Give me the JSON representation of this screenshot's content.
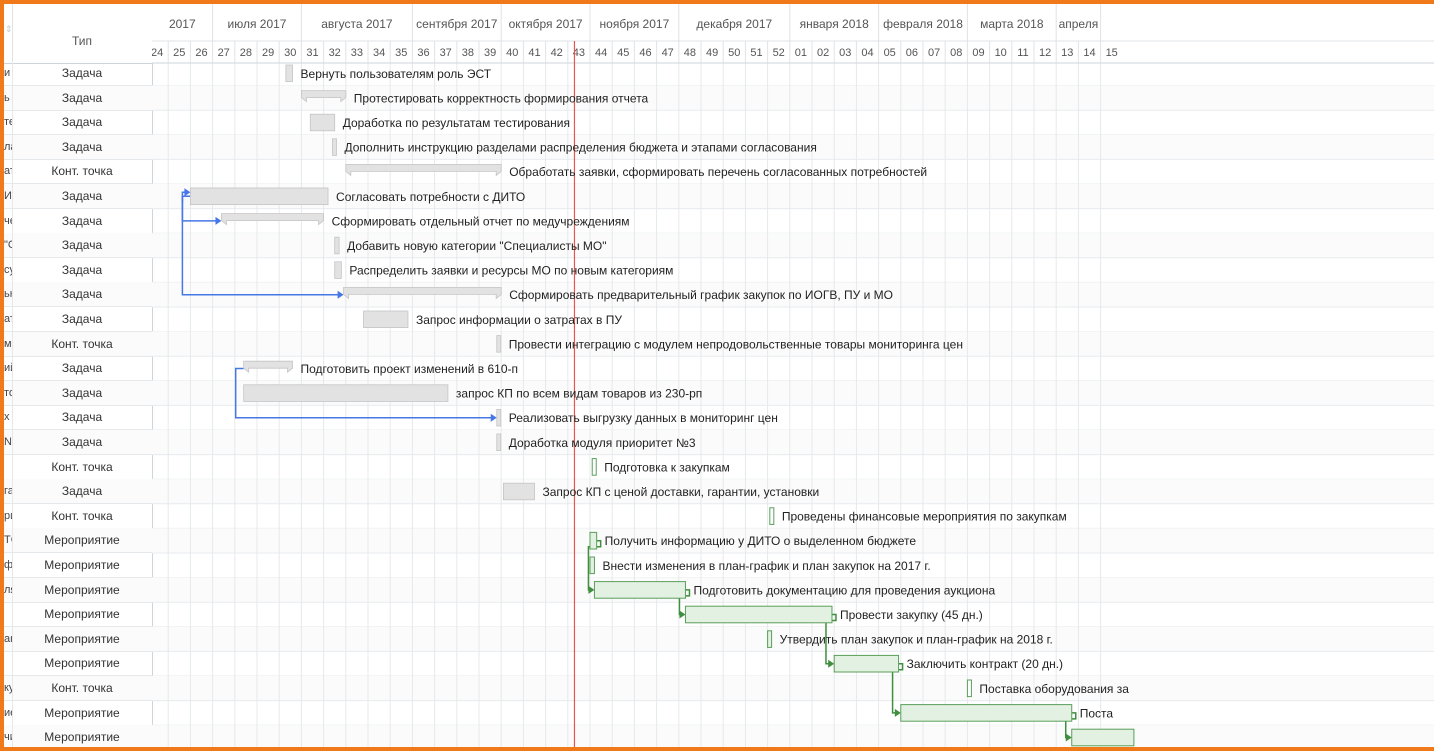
{
  "columns": {
    "type_header": "Тип",
    "sort_icon": "sort-icon"
  },
  "timeline": {
    "months": [
      {
        "label": "2017",
        "from": 24,
        "to": 26
      },
      {
        "label": "июля 2017",
        "from": 27,
        "to": 30
      },
      {
        "label": "августа 2017",
        "from": 31,
        "to": 35
      },
      {
        "label": "сентября 2017",
        "from": 36,
        "to": 39
      },
      {
        "label": "октября 2017",
        "from": 40,
        "to": 43
      },
      {
        "label": "ноября 2017",
        "from": 44,
        "to": 47
      },
      {
        "label": "декабря 2017",
        "from": 48,
        "to": 52
      },
      {
        "label": "января 2018",
        "from": 53,
        "to": 56
      },
      {
        "label": "февраля 2018",
        "from": 57,
        "to": 60
      },
      {
        "label": "марта 2018",
        "from": 61,
        "to": 64
      },
      {
        "label": "апреля",
        "from": 65,
        "to": 66
      }
    ],
    "weeks": [
      "24",
      "25",
      "26",
      "27",
      "28",
      "29",
      "30",
      "31",
      "32",
      "33",
      "34",
      "35",
      "36",
      "37",
      "38",
      "39",
      "40",
      "41",
      "42",
      "43",
      "44",
      "45",
      "46",
      "47",
      "48",
      "49",
      "50",
      "51",
      "52",
      "01",
      "02",
      "03",
      "04",
      "05",
      "06",
      "07",
      "08",
      "09",
      "10",
      "11",
      "12",
      "13",
      "14",
      "15"
    ],
    "today_week": 43.3,
    "colors": {
      "task_fill": "#e2e2e2",
      "task_border": "#c4c4c4",
      "green_fill": "#e3f1e3",
      "green_border": "#5a9e5a",
      "link_blue": "#4677e6",
      "link_green": "#3f8f3f",
      "today_line": "#e8564f"
    }
  },
  "rows": [
    {
      "left": "и",
      "type": "Задача",
      "bar": {
        "kind": "task",
        "start": 30.3,
        "end": 30.6
      },
      "label": "Вернуть пользователям роль ЭСТ"
    },
    {
      "left": "ь с",
      "type": "Задача",
      "bar": {
        "kind": "summary",
        "start": 31.0,
        "end": 33.0
      },
      "label": "Протестировать корректность формирования отчета"
    },
    {
      "left": "те",
      "type": "Задача",
      "bar": {
        "kind": "task",
        "start": 31.4,
        "end": 32.5
      },
      "label": "Доработка по результатам тестирования"
    },
    {
      "left": "ла",
      "type": "Задача",
      "bar": {
        "kind": "task",
        "start": 32.4,
        "end": 32.5
      },
      "label": "Дополнить инструкцию разделами распределения бюджета и этапами согласования"
    },
    {
      "left": "ат",
      "type": "Конт. точка",
      "bar": {
        "kind": "summary",
        "start": 33.0,
        "end": 40.0
      },
      "label": "Обработать заявки, сформировать перечень согласованных потребностей"
    },
    {
      "left": "И",
      "type": "Задача",
      "bar": {
        "kind": "task",
        "start": 26.0,
        "end": 32.2
      },
      "label": "Согласовать потребности с ДИТО"
    },
    {
      "left": "че",
      "type": "Задача",
      "bar": {
        "kind": "summary",
        "start": 27.4,
        "end": 32.0
      },
      "label": "Сформировать отдельный отчет по медучреждениям"
    },
    {
      "left": "\"С",
      "type": "Задача",
      "bar": {
        "kind": "task",
        "start": 32.5,
        "end": 32.7
      },
      "label": "Добавить новую категории \"Специалисты МО\""
    },
    {
      "left": "су",
      "type": "Задача",
      "bar": {
        "kind": "task",
        "start": 32.5,
        "end": 32.8
      },
      "label": "Распределить заявки и ресурсы МО по новым категориям"
    },
    {
      "left": "ьн",
      "type": "Задача",
      "bar": {
        "kind": "summary",
        "start": 32.9,
        "end": 40.0
      },
      "label": "Сформировать предварительный график закупок по ИОГВ, ПУ и МО"
    },
    {
      "left": "ат",
      "type": "Задача",
      "bar": {
        "kind": "task",
        "start": 33.8,
        "end": 35.8
      },
      "label": "Запрос информации о затратах в ПУ"
    },
    {
      "left": "м",
      "type": "Конт. точка",
      "bar": {
        "kind": "task",
        "start": 39.8,
        "end": 39.95
      },
      "label": "Провести интеграцию с модулем непродовольственные товары мониторинга цен"
    },
    {
      "left": "ий",
      "type": "Задача",
      "bar": {
        "kind": "summary",
        "start": 28.4,
        "end": 30.6
      },
      "label": "Подготовить проект изменений в 610-п"
    },
    {
      "left": "то",
      "type": "Задача",
      "bar": {
        "kind": "task",
        "start": 28.4,
        "end": 37.6
      },
      "label": "запрос КП по всем видам товаров из 230-рп"
    },
    {
      "left": "х в",
      "type": "Задача",
      "bar": {
        "kind": "task",
        "start": 39.8,
        "end": 39.95
      },
      "label": "Реализовать выгрузку данных в мониторинг цен"
    },
    {
      "left": "N",
      "type": "Задача",
      "bar": {
        "kind": "task",
        "start": 39.8,
        "end": 39.95
      },
      "label": "Доработка модуля приоритет №3"
    },
    {
      "left": "",
      "type": "Конт. точка",
      "bar": {
        "kind": "milestone",
        "start": 44.1,
        "end": 44.2
      },
      "label": "Подготовка к закупкам"
    },
    {
      "left": "га",
      "type": "Задача",
      "bar": {
        "kind": "task",
        "start": 40.1,
        "end": 41.5
      },
      "label": "Запрос КП с ценой доставки, гарантии, установки"
    },
    {
      "left": "ри",
      "type": "Конт. точка",
      "bar": {
        "kind": "milestone",
        "start": 52.1,
        "end": 52.2
      },
      "label": "Проведены финансовые мероприятия по закупкам"
    },
    {
      "left": "ТС",
      "type": "Мероприятие",
      "bar": {
        "kind": "green",
        "start": 44.0,
        "end": 44.3
      },
      "label": "Получить информацию у ДИТО о выделенном бюджете"
    },
    {
      "left": "ф",
      "type": "Мероприятие",
      "bar": {
        "kind": "green",
        "start": 44.0,
        "end": 44.2
      },
      "label": "Внести изменения в план-график и план закупок на 2017 г."
    },
    {
      "left": "ля",
      "type": "Мероприятие",
      "bar": {
        "kind": "green",
        "start": 44.2,
        "end": 48.3
      },
      "label": "Подготовить документацию для проведения аукциона"
    },
    {
      "left": "",
      "type": "Мероприятие",
      "bar": {
        "kind": "green",
        "start": 48.3,
        "end": 54.9
      },
      "label": "Провести закупку (45 дн.)"
    },
    {
      "left": "ан",
      "type": "Мероприятие",
      "bar": {
        "kind": "green",
        "start": 52.0,
        "end": 52.1
      },
      "label": "Утвердить план закупок и план-график на 2018 г."
    },
    {
      "left": "",
      "type": "Мероприятие",
      "bar": {
        "kind": "green",
        "start": 55.0,
        "end": 57.9
      },
      "label": "Заключить контракт (20 дн.)"
    },
    {
      "left": "ку",
      "type": "Конт. точка",
      "bar": {
        "kind": "milestone",
        "start": 61.0,
        "end": 61.1
      },
      "label": "Поставка оборудования за"
    },
    {
      "left": "ие",
      "type": "Мероприятие",
      "bar": {
        "kind": "green",
        "start": 58.0,
        "end": 65.7
      },
      "label": "Поста"
    },
    {
      "left": "чи",
      "type": "Мероприятие",
      "bar": {
        "kind": "green",
        "start": 65.7,
        "end": 68.5
      },
      "label": ""
    }
  ],
  "links": [
    {
      "kind": "blue",
      "from_row": 5,
      "to_row": 5
    },
    {
      "kind": "blue",
      "from_row": 5,
      "to_row": 6
    },
    {
      "kind": "blue",
      "from_row": 5,
      "to_row": 9
    },
    {
      "kind": "blue",
      "from_row": 12,
      "to_row": 14
    },
    {
      "kind": "green",
      "from_row": 19,
      "to_row": 21
    },
    {
      "kind": "green",
      "from_row": 21,
      "to_row": 22
    },
    {
      "kind": "green",
      "from_row": 22,
      "to_row": 24
    },
    {
      "kind": "green",
      "from_row": 24,
      "to_row": 26
    },
    {
      "kind": "green",
      "from_row": 26,
      "to_row": 27
    }
  ]
}
